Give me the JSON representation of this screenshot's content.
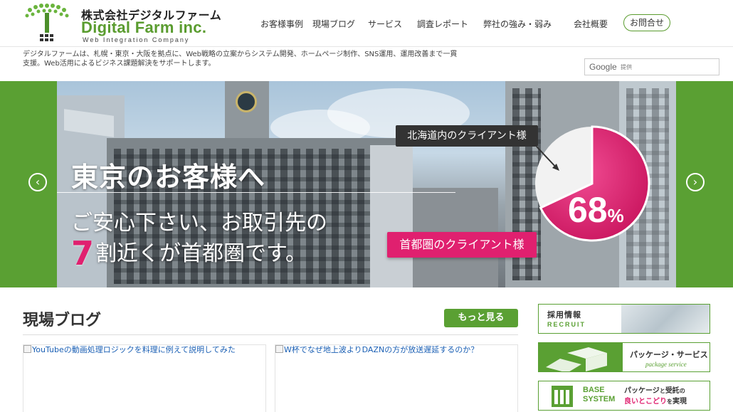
{
  "header": {
    "logo_jp": "株式会社デジタルファーム",
    "logo_en": "Digital Farm inc.",
    "logo_sub": "Web Integration Company",
    "nav": [
      "お客様事例",
      "現場ブログ",
      "サービス",
      "調査レポート",
      "弊社の強み・弱み",
      "会社概要"
    ],
    "contact": "お問合せ"
  },
  "intro": {
    "text": "デジタルファームは、札幌・東京・大阪を拠点に、Web戦略の立案からシステム開発、ホームページ制作、SNS運用、運用改善まで一貫支援。Web活用によるビジネス課題解決をサポートします。"
  },
  "search": {
    "brand": "Google",
    "label": "提供"
  },
  "hero": {
    "title": "東京のお客様へ",
    "line1": "ご安心下さい、お取引先の",
    "big_number": "7",
    "line2_rest": "割近くが首都圏です。",
    "callout_top": "北海道内のクライアント様",
    "callout_bottom": "首都圏のクライアント様",
    "percent_number": "68",
    "percent_sign": "%",
    "pie_share": 0.68,
    "prev": "‹",
    "next": "›"
  },
  "blog": {
    "title": "現場ブログ",
    "more": "もっと見る",
    "posts": [
      "YouTubeの動画処理ロジックを料理に例えて説明してみた",
      "W杯でなぜ地上波よりDAZNの方が放送遅延するのか？"
    ]
  },
  "banners": {
    "recruit_jp": "採用情報",
    "recruit_en": "RECRUIT",
    "package_jp": "パッケージ・サービス",
    "package_en": "package service",
    "base_line1": "BASE",
    "base_line2": "SYSTEM",
    "base_copy1a": "パッケージ",
    "base_copy1b": "と",
    "base_copy1c": "受託",
    "base_copy1d": "の",
    "base_copy2a": "良いとこどり",
    "base_copy2b": "を",
    "base_copy2c": "実現"
  },
  "colors": {
    "brand_green": "#5aa033",
    "accent_pink": "#e0206f"
  }
}
